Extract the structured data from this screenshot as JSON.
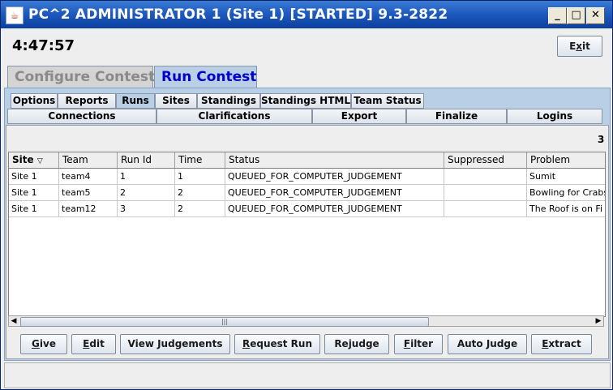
{
  "window": {
    "title": "PC^2 ADMINISTRATOR 1 (Site 1) [STARTED] 9.3-2822",
    "minimize": "_",
    "maximize": "□",
    "close": "✕"
  },
  "clock": "4:47:57",
  "exit_button": {
    "label": "Exit",
    "mnemonic": "x"
  },
  "main_tabs": [
    {
      "label": "Configure Contest",
      "active": false
    },
    {
      "label": "Run Contest",
      "active": true
    }
  ],
  "sub_tabs_row1": [
    "Options",
    "Reports",
    "Runs",
    "Sites",
    "Standings",
    "Standings HTML",
    "Team Status"
  ],
  "active_sub_tab": "Runs",
  "sub_tabs_row2": [
    "Connections",
    "Clarifications",
    "Export",
    "Finalize",
    "Logins"
  ],
  "run_count": "3",
  "runs_table": {
    "columns": [
      "Site",
      "Team",
      "Run Id",
      "Time",
      "Status",
      "Suppressed",
      "Problem"
    ],
    "sort_indicator": "▽",
    "rows": [
      [
        "Site 1",
        "team4",
        "1",
        "1",
        "QUEUED_FOR_COMPUTER_JUDGEMENT",
        "",
        "Sumit"
      ],
      [
        "Site 1",
        "team5",
        "2",
        "2",
        "QUEUED_FOR_COMPUTER_JUDGEMENT",
        "",
        "Bowling for Crabs"
      ],
      [
        "Site 1",
        "team12",
        "3",
        "2",
        "QUEUED_FOR_COMPUTER_JUDGEMENT",
        "",
        "The Roof is on Fi"
      ]
    ]
  },
  "scrollbar": {
    "left": "◀",
    "right": "▶",
    "grip": "|||"
  },
  "action_buttons": [
    {
      "label": "Give",
      "ul": "G",
      "rest": "ive"
    },
    {
      "label": "Edit",
      "ul": "E",
      "rest": "dit"
    },
    {
      "label": "View Judgements",
      "ul": "",
      "rest": "View Judgements"
    },
    {
      "label": "Request Run",
      "ul": "R",
      "rest": "equest Run"
    },
    {
      "label": "Rejudge",
      "ul": "",
      "rest": "Rejudge"
    },
    {
      "label": "Filter",
      "ul": "F",
      "rest": "ilter"
    },
    {
      "label": "Auto Judge",
      "ul": "",
      "rest": "Auto Judge"
    },
    {
      "label": "Extract",
      "ul": "E",
      "rest": "xtract"
    }
  ],
  "colors": {
    "title_bar": "#1f5bbf",
    "tab_panel": "#b8cfe5",
    "active_tab_text": "#0000cc"
  }
}
